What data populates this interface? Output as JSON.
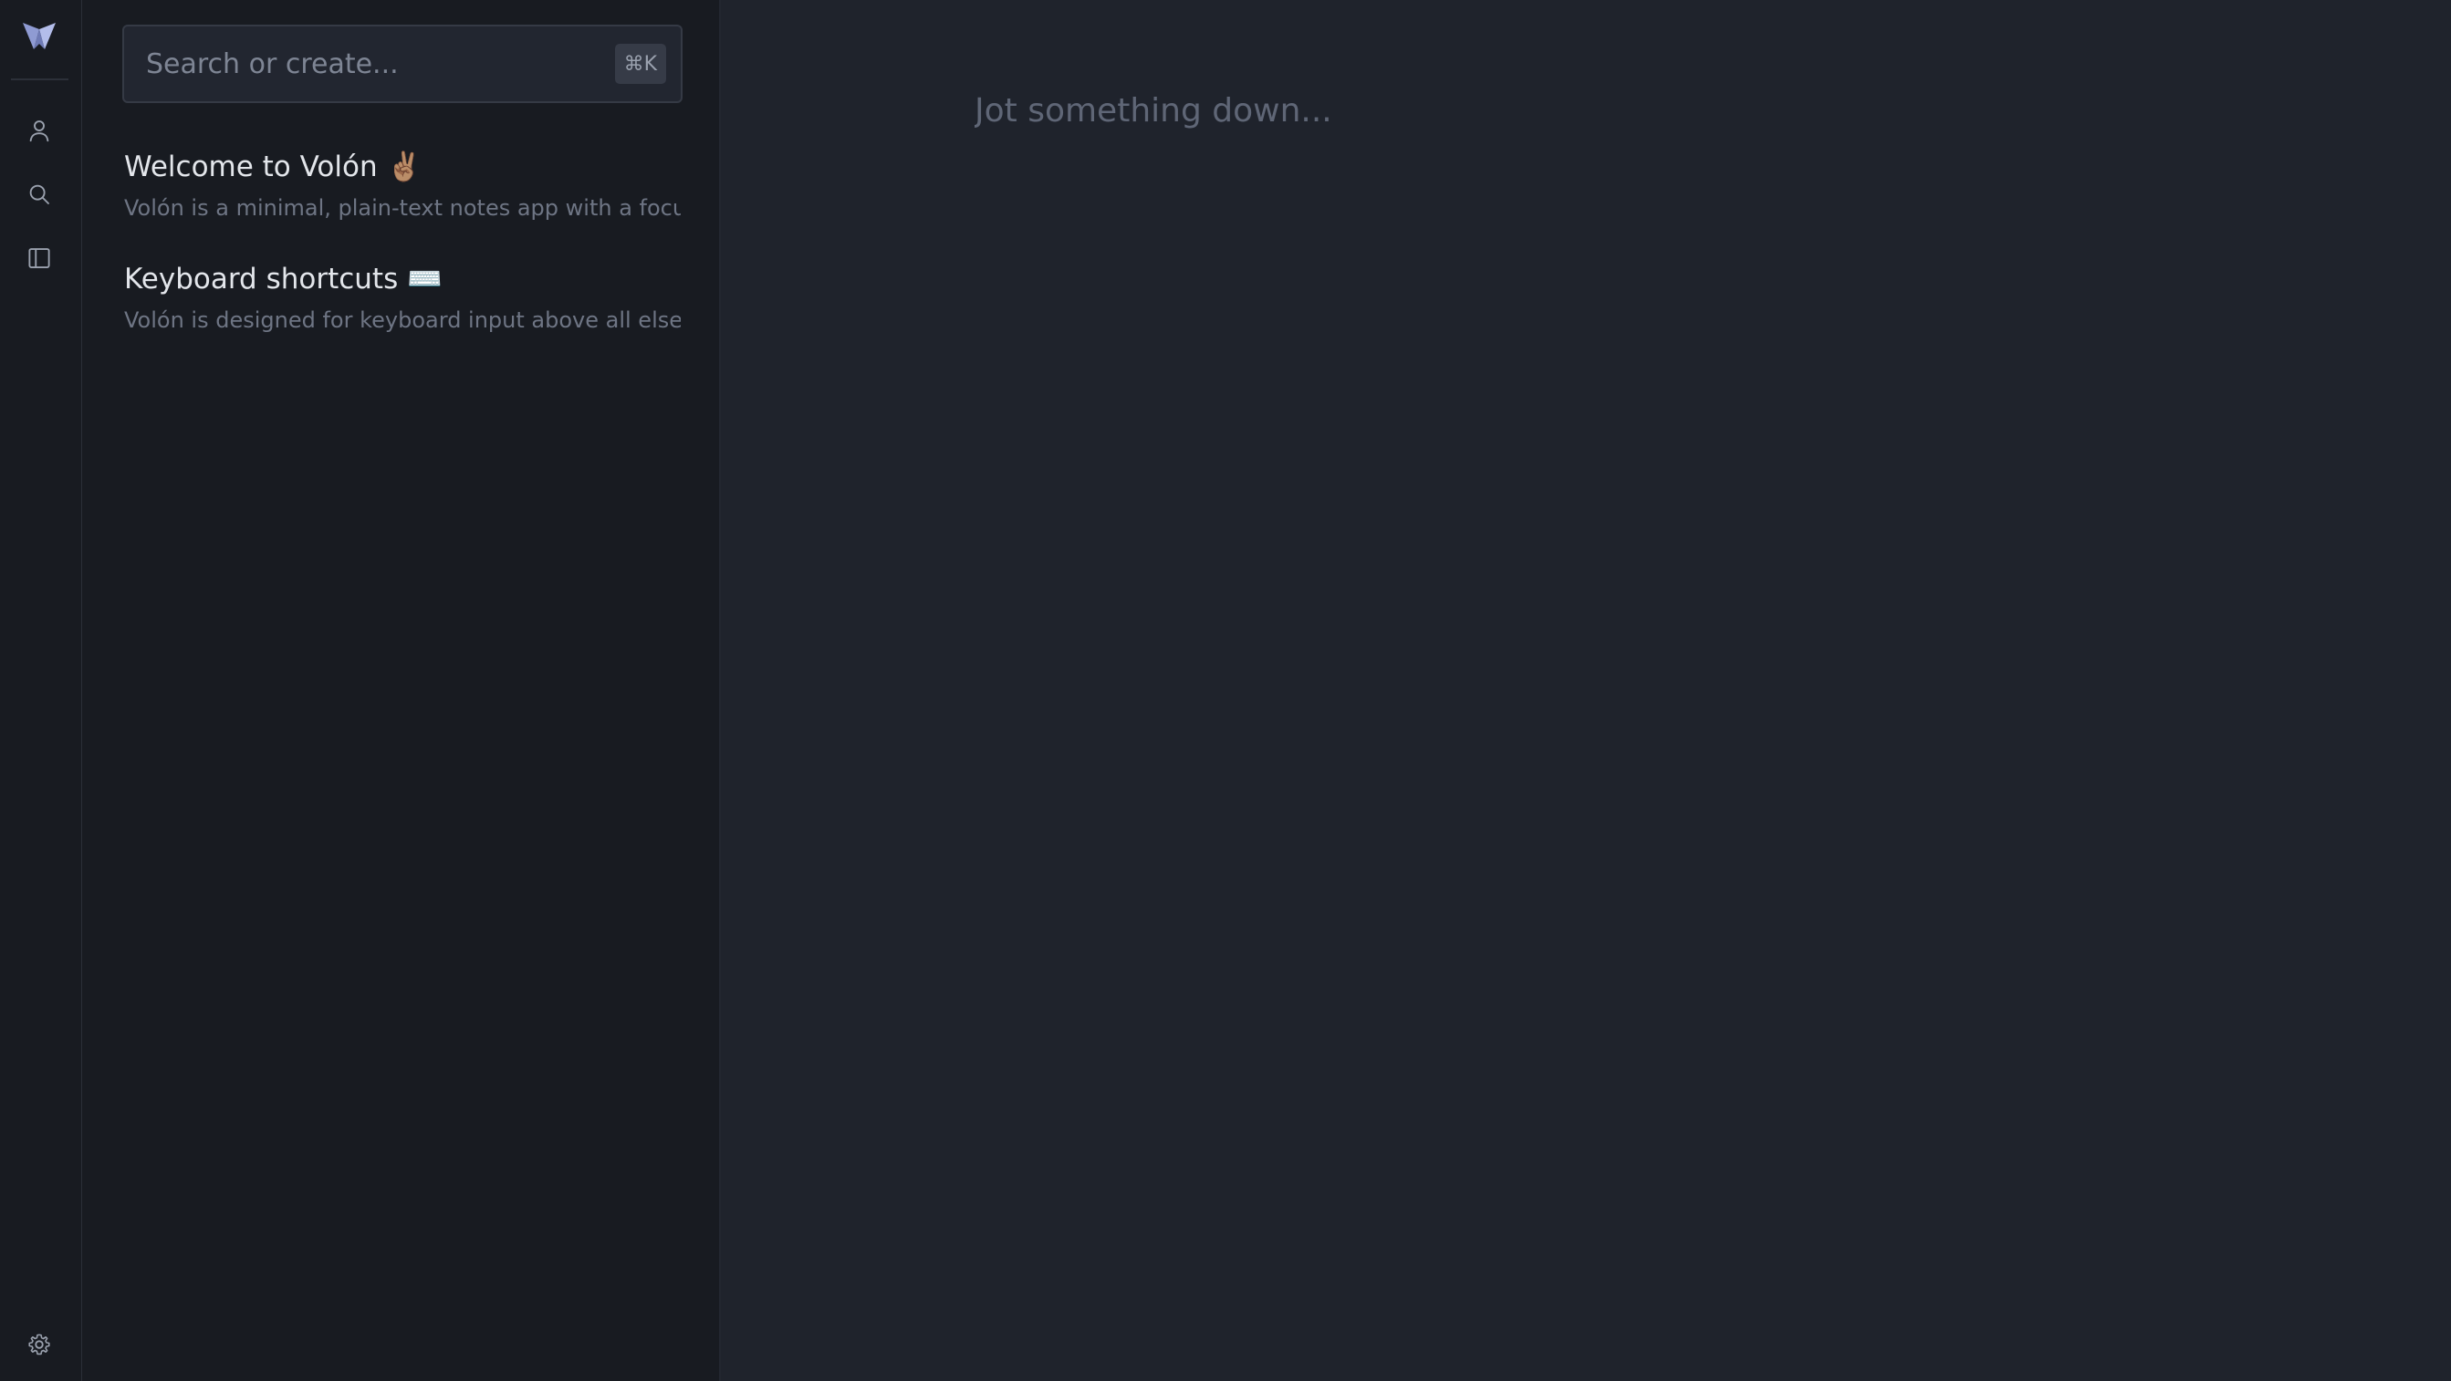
{
  "app": {
    "name": "Volón",
    "accent_color": "#a9b4e6",
    "logo_icon": "volon-logo-icon"
  },
  "rail": {
    "items": [
      {
        "name": "account",
        "icon": "user-icon"
      },
      {
        "name": "search",
        "icon": "search-icon"
      },
      {
        "name": "toggle-sidebar",
        "icon": "sidebar-panel-icon"
      }
    ],
    "bottom": {
      "name": "settings",
      "icon": "gear-icon"
    }
  },
  "search": {
    "placeholder": "Search or create...",
    "value": "",
    "shortcut": "⌘K"
  },
  "notes": [
    {
      "title": "Welcome to Volón ✌🏽",
      "preview": "Volón is a minimal, plain-text notes app with a focu..."
    },
    {
      "title": "Keyboard shortcuts ⌨️",
      "preview": "Volón is designed for keyboard input above all else,..."
    }
  ],
  "editor": {
    "placeholder": "Jot something down...",
    "value": ""
  }
}
